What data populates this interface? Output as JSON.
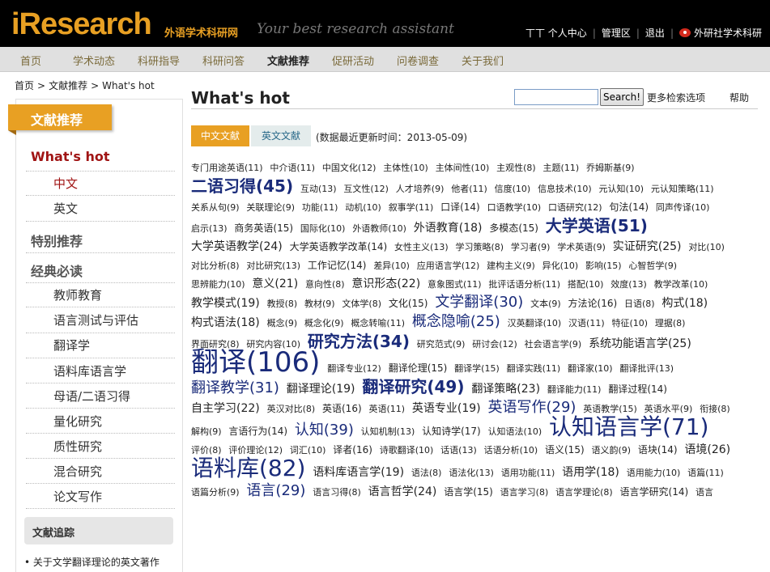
{
  "header": {
    "logo": "iResearch",
    "logo_cn": "外语学术科研网",
    "slogan": "Your best research assistant",
    "user": "丅丅",
    "links": [
      "个人中心",
      "管理区",
      "退出"
    ],
    "weibo_link": "外研社学术科研"
  },
  "nav": {
    "items": [
      "首页",
      "学术动态",
      "科研指导",
      "科研问答",
      "文献推荐",
      "促研活动",
      "问卷调查",
      "关于我们"
    ],
    "active": "文献推荐"
  },
  "breadcrumb": [
    "首页",
    "文献推荐",
    "What's hot"
  ],
  "sidebar": {
    "tab": "文献推荐",
    "sections": [
      {
        "title": "What's hot",
        "items": [
          "中文",
          "英文"
        ]
      },
      {
        "title": "特别推荐",
        "items": []
      },
      {
        "title": "经典必读",
        "items": [
          "教师教育",
          "语言测试与评估",
          "翻译学",
          "语料库语言学",
          "母语/二语习得",
          "量化研究",
          "质性研究",
          "混合研究",
          "论文写作"
        ]
      }
    ],
    "track_title": "文献追踪",
    "track_link": "关于文学翻译理论的英文著作"
  },
  "main": {
    "title": "What's hot",
    "search_value": "",
    "search_button": "Search!",
    "advanced": "更多检索选项",
    "help": "帮助",
    "tab_cn": "中文文献",
    "tab_en": "英文文献",
    "update_note": "(数据最近更新时间：2013-05-09)"
  },
  "tags": [
    {
      "t": "专门用途英语(11)",
      "s": 1
    },
    {
      "t": "中介语(11)",
      "s": 1
    },
    {
      "t": "中国文化(12)",
      "s": 1
    },
    {
      "t": "主体性(10)",
      "s": 1
    },
    {
      "t": "主体间性(10)",
      "s": 1
    },
    {
      "t": "主观性(8)",
      "s": 1
    },
    {
      "t": "主题(11)",
      "s": 1
    },
    {
      "t": "乔姆斯基(9)",
      "s": 1
    },
    {
      "t": "二语习得(45)",
      "s": 5
    },
    {
      "t": "互动(13)",
      "s": 1
    },
    {
      "t": "互文性(12)",
      "s": 1
    },
    {
      "t": "人才培养(9)",
      "s": 1
    },
    {
      "t": "他者(11)",
      "s": 1
    },
    {
      "t": "信度(10)",
      "s": 1
    },
    {
      "t": "信息技术(10)",
      "s": 1
    },
    {
      "t": "元认知(10)",
      "s": 1
    },
    {
      "t": "元认知策略(11)",
      "s": 1
    },
    {
      "t": "关系从句(9)",
      "s": 1
    },
    {
      "t": "关联理论(9)",
      "s": 1
    },
    {
      "t": "功能(11)",
      "s": 1
    },
    {
      "t": "动机(10)",
      "s": 1
    },
    {
      "t": "叙事学(11)",
      "s": 1
    },
    {
      "t": "口译(14)",
      "s": 2
    },
    {
      "t": "口语教学(10)",
      "s": 1
    },
    {
      "t": "口语研究(12)",
      "s": 1
    },
    {
      "t": "句法(14)",
      "s": 2
    },
    {
      "t": "同声传译(10)",
      "s": 1
    },
    {
      "t": "启示(13)",
      "s": 1
    },
    {
      "t": "商务英语(15)",
      "s": 2
    },
    {
      "t": "国际化(10)",
      "s": 1
    },
    {
      "t": "外语教师(10)",
      "s": 1
    },
    {
      "t": "外语教育(18)",
      "s": 3
    },
    {
      "t": "多模态(15)",
      "s": 2
    },
    {
      "t": "大学英语(51)",
      "s": 5
    },
    {
      "t": "大学英语教学(24)",
      "s": 3
    },
    {
      "t": "大学英语教学改革(14)",
      "s": 2
    },
    {
      "t": "女性主义(13)",
      "s": 1
    },
    {
      "t": "学习策略(8)",
      "s": 1
    },
    {
      "t": "学习者(9)",
      "s": 1
    },
    {
      "t": "学术英语(9)",
      "s": 1
    },
    {
      "t": "实证研究(25)",
      "s": 3
    },
    {
      "t": "对比(10)",
      "s": 1
    },
    {
      "t": "对比分析(8)",
      "s": 1
    },
    {
      "t": "对比研究(13)",
      "s": 1
    },
    {
      "t": "工作记忆(14)",
      "s": 2
    },
    {
      "t": "差异(10)",
      "s": 1
    },
    {
      "t": "应用语言学(12)",
      "s": 1
    },
    {
      "t": "建构主义(9)",
      "s": 1
    },
    {
      "t": "异化(10)",
      "s": 1
    },
    {
      "t": "影响(15)",
      "s": 1
    },
    {
      "t": "心智哲学(9)",
      "s": 1
    },
    {
      "t": "思辨能力(10)",
      "s": 1
    },
    {
      "t": "意义(21)",
      "s": 3
    },
    {
      "t": "意向性(8)",
      "s": 1
    },
    {
      "t": "意识形态(22)",
      "s": 3
    },
    {
      "t": "意象图式(11)",
      "s": 1
    },
    {
      "t": "批评话语分析(11)",
      "s": 1
    },
    {
      "t": "搭配(10)",
      "s": 1
    },
    {
      "t": "效度(13)",
      "s": 1
    },
    {
      "t": "教学改革(10)",
      "s": 1
    },
    {
      "t": "教学模式(19)",
      "s": 3
    },
    {
      "t": "教授(8)",
      "s": 1
    },
    {
      "t": "教材(9)",
      "s": 1
    },
    {
      "t": "文体学(8)",
      "s": 1
    },
    {
      "t": "文化(15)",
      "s": 2
    },
    {
      "t": "文学翻译(30)",
      "s": 4
    },
    {
      "t": "文本(9)",
      "s": 1
    },
    {
      "t": "方法论(16)",
      "s": 2
    },
    {
      "t": "日语(8)",
      "s": 1
    },
    {
      "t": "构式(18)",
      "s": 3
    },
    {
      "t": "构式语法(18)",
      "s": 3
    },
    {
      "t": "概念(9)",
      "s": 1
    },
    {
      "t": "概念化(9)",
      "s": 1
    },
    {
      "t": "概念转喻(11)",
      "s": 1
    },
    {
      "t": "概念隐喻(25)",
      "s": 4
    },
    {
      "t": "汉英翻译(10)",
      "s": 1
    },
    {
      "t": "汉语(11)",
      "s": 1
    },
    {
      "t": "特征(10)",
      "s": 1
    },
    {
      "t": "理据(8)",
      "s": 1
    },
    {
      "t": "界面研究(8)",
      "s": 1
    },
    {
      "t": "研究内容(10)",
      "s": 1
    },
    {
      "t": "研究方法(34)",
      "s": 5
    },
    {
      "t": "研究范式(9)",
      "s": 1
    },
    {
      "t": "研讨会(12)",
      "s": 1
    },
    {
      "t": "社会语言学(9)",
      "s": 1
    },
    {
      "t": "系统功能语言学(25)",
      "s": 3
    },
    {
      "t": "翻译(106)",
      "s": 7
    },
    {
      "t": "翻译专业(12)",
      "s": 1
    },
    {
      "t": "翻译伦理(15)",
      "s": 2
    },
    {
      "t": "翻译学(15)",
      "s": 1
    },
    {
      "t": "翻译实践(11)",
      "s": 1
    },
    {
      "t": "翻译家(10)",
      "s": 1
    },
    {
      "t": "翻译批评(13)",
      "s": 1
    },
    {
      "t": "翻译教学(31)",
      "s": 4
    },
    {
      "t": "翻译理论(19)",
      "s": 3
    },
    {
      "t": "翻译研究(49)",
      "s": 5
    },
    {
      "t": "翻译策略(23)",
      "s": 3
    },
    {
      "t": "翻译能力(11)",
      "s": 1
    },
    {
      "t": "翻译过程(14)",
      "s": 2
    },
    {
      "t": "自主学习(22)",
      "s": 3
    },
    {
      "t": "英汉对比(8)",
      "s": 1
    },
    {
      "t": "英语(16)",
      "s": 2
    },
    {
      "t": "英语(11)",
      "s": 1
    },
    {
      "t": "英语专业(19)",
      "s": 3
    },
    {
      "t": "英语写作(29)",
      "s": 4
    },
    {
      "t": "英语教学(15)",
      "s": 1
    },
    {
      "t": "英语水平(9)",
      "s": 1
    },
    {
      "t": "衔接(8)",
      "s": 1
    },
    {
      "t": "解构(9)",
      "s": 1
    },
    {
      "t": "言语行为(14)",
      "s": 2
    },
    {
      "t": "认知(39)",
      "s": 4
    },
    {
      "t": "认知机制(13)",
      "s": 1
    },
    {
      "t": "认知诗学(17)",
      "s": 2
    },
    {
      "t": "认知语法(10)",
      "s": 1
    },
    {
      "t": "认知语言学(71)",
      "s": 6
    },
    {
      "t": "评价(8)",
      "s": 1
    },
    {
      "t": "评价理论(12)",
      "s": 1
    },
    {
      "t": "词汇(10)",
      "s": 1
    },
    {
      "t": "译者(16)",
      "s": 2
    },
    {
      "t": "诗歌翻译(10)",
      "s": 1
    },
    {
      "t": "话语(13)",
      "s": 1
    },
    {
      "t": "话语分析(10)",
      "s": 1
    },
    {
      "t": "语义(15)",
      "s": 2
    },
    {
      "t": "语义韵(9)",
      "s": 1
    },
    {
      "t": "语块(14)",
      "s": 2
    },
    {
      "t": "语境(26)",
      "s": 3
    },
    {
      "t": "语料库(82)",
      "s": 6
    },
    {
      "t": "语料库语言学(19)",
      "s": 3
    },
    {
      "t": "语法(8)",
      "s": 1
    },
    {
      "t": "语法化(13)",
      "s": 1
    },
    {
      "t": "语用功能(11)",
      "s": 1
    },
    {
      "t": "语用学(18)",
      "s": 3
    },
    {
      "t": "语用能力(10)",
      "s": 1
    },
    {
      "t": "语篇(11)",
      "s": 1
    },
    {
      "t": "语篇分析(9)",
      "s": 1
    },
    {
      "t": "语言(29)",
      "s": 4
    },
    {
      "t": "语言习得(8)",
      "s": 1
    },
    {
      "t": "语言哲学(24)",
      "s": 3
    },
    {
      "t": "语言学(15)",
      "s": 2
    },
    {
      "t": "语言学习(8)",
      "s": 1
    },
    {
      "t": "语言学理论(8)",
      "s": 1
    },
    {
      "t": "语言学研究(14)",
      "s": 2
    },
    {
      "t": "语言",
      "s": 1
    }
  ]
}
